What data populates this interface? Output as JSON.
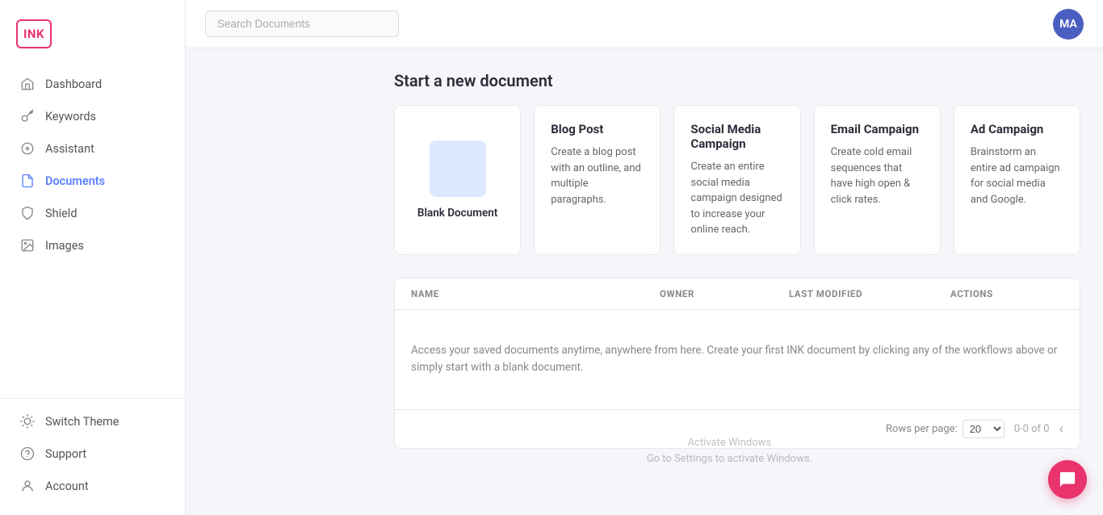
{
  "logo": "INK",
  "avatar_initials": "MA",
  "search_placeholder": "Search Documents",
  "sidebar": {
    "items": [
      {
        "id": "dashboard",
        "label": "Dashboard",
        "icon": "home-icon",
        "active": false
      },
      {
        "id": "keywords",
        "label": "Keywords",
        "icon": "key-icon",
        "active": false
      },
      {
        "id": "assistant",
        "label": "Assistant",
        "icon": "assistant-icon",
        "active": false
      },
      {
        "id": "documents",
        "label": "Documents",
        "icon": "docs-icon",
        "active": true
      },
      {
        "id": "shield",
        "label": "Shield",
        "icon": "shield-icon",
        "active": false
      },
      {
        "id": "images",
        "label": "Images",
        "icon": "images-icon",
        "active": false
      }
    ],
    "bottom_items": [
      {
        "id": "switch-theme",
        "label": "Switch Theme",
        "icon": "theme-icon"
      },
      {
        "id": "support",
        "label": "Support",
        "icon": "support-icon"
      },
      {
        "id": "account",
        "label": "Account",
        "icon": "account-icon"
      }
    ]
  },
  "page_title": "Start a new document",
  "cards": [
    {
      "id": "blank",
      "title": "Blank Document",
      "description": "",
      "is_blank": true
    },
    {
      "id": "blog-post",
      "title": "Blog Post",
      "description": "Create a blog post with an outline, and multiple paragraphs.",
      "is_blank": false
    },
    {
      "id": "social-media",
      "title": "Social Media Campaign",
      "description": "Create an entire social media campaign designed to increase your online reach.",
      "is_blank": false
    },
    {
      "id": "email-campaign",
      "title": "Email Campaign",
      "description": "Create cold email sequences that have high open & click rates.",
      "is_blank": false
    },
    {
      "id": "ad-campaign",
      "title": "Ad Campaign",
      "description": "Brainstorm an entire ad campaign for social media and Google.",
      "is_blank": false
    }
  ],
  "table": {
    "columns": [
      "NAME",
      "OWNER",
      "LAST MODIFIED",
      "ACTIONS"
    ],
    "empty_message": "Access your saved documents anytime, anywhere from here. Create your first INK document by clicking any of the workflows above or simply start with a blank document."
  },
  "footer": {
    "rows_label": "Rows per page:",
    "rows_value": "20",
    "pagination": "0-0 of 0"
  },
  "watermark_line1": "Activate Windows",
  "watermark_line2": "Go to Settings to activate Windows."
}
